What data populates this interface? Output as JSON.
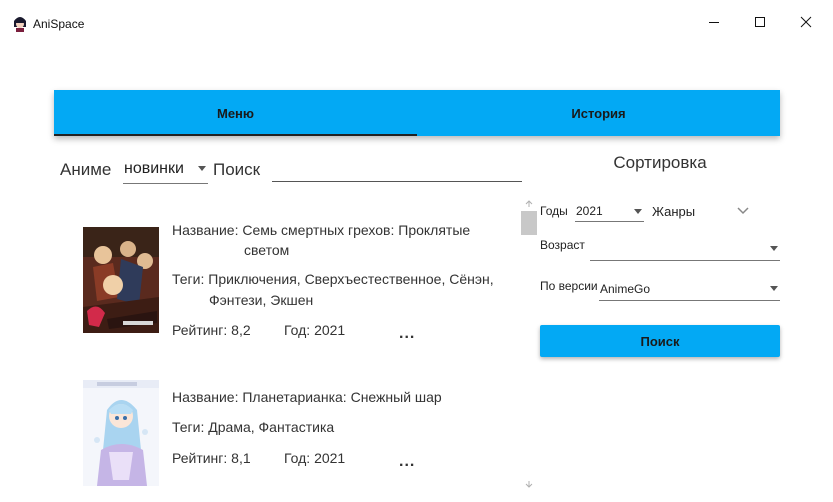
{
  "window": {
    "title": "AniSpace"
  },
  "tabs": [
    {
      "label": "Меню",
      "active": true
    },
    {
      "label": "История",
      "active": false
    }
  ],
  "search": {
    "anime_label": "Аниме",
    "filter_value": "новинки",
    "search_label": "Поиск",
    "query": ""
  },
  "results": [
    {
      "title_prefix": "Название:",
      "title_line1": "Семь смертных грехов: Проклятые",
      "title_line2": "светом",
      "tags_prefix": "Теги:",
      "tags_line1": "Приключения, Сверхъестественное, Сёнэн,",
      "tags_line2": "Фэнтези, Экшен",
      "rating": "Рейтинг: 8,2",
      "year": "Год: 2021",
      "more": "..."
    },
    {
      "title_prefix": "Название:",
      "title_line1": "Планетарианка: Снежный шар",
      "tags_prefix": "Теги:",
      "tags_line1": "Драма, Фантастика",
      "rating": "Рейтинг: 8,1",
      "year": "Год: 2021",
      "more": "..."
    }
  ],
  "sort": {
    "title": "Сортировка",
    "years_label": "Годы",
    "years_value": "2021",
    "genres_label": "Жанры",
    "age_label": "Возраст",
    "age_value": "",
    "version_label": "По версии",
    "version_value": "AnimeGo",
    "search_button": "Поиск"
  },
  "colors": {
    "accent": "#03a9f4",
    "tab_indicator": "#222222"
  },
  "icons": {
    "app": "anime-avatar-icon",
    "window_controls": [
      "minimize-icon",
      "maximize-icon",
      "close-icon"
    ],
    "genres": "chevron-down-icon"
  }
}
